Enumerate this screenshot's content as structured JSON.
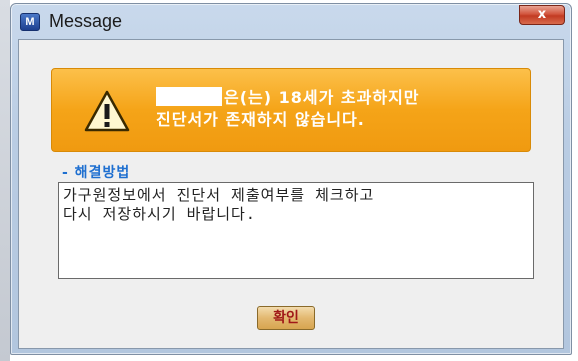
{
  "window": {
    "title": "Message",
    "close_glyph": "x",
    "app_icon": "app-icon"
  },
  "banner": {
    "icon": "warning-icon",
    "line1": "은(는) 18세가 초과하지만",
    "line2": "진단서가 존재하지 않습니다."
  },
  "resolution": {
    "label": "- 해결방법",
    "lines": [
      "가구원정보에서 진단서 제출여부를 체크하고",
      "다시 저장하시기 바랍니다."
    ]
  },
  "buttons": {
    "ok_label": "확인"
  },
  "colors": {
    "banner": "#f5a418",
    "section_label": "#1e6fd0",
    "ok_text": "#a01818",
    "close_button": "#c23a22"
  }
}
